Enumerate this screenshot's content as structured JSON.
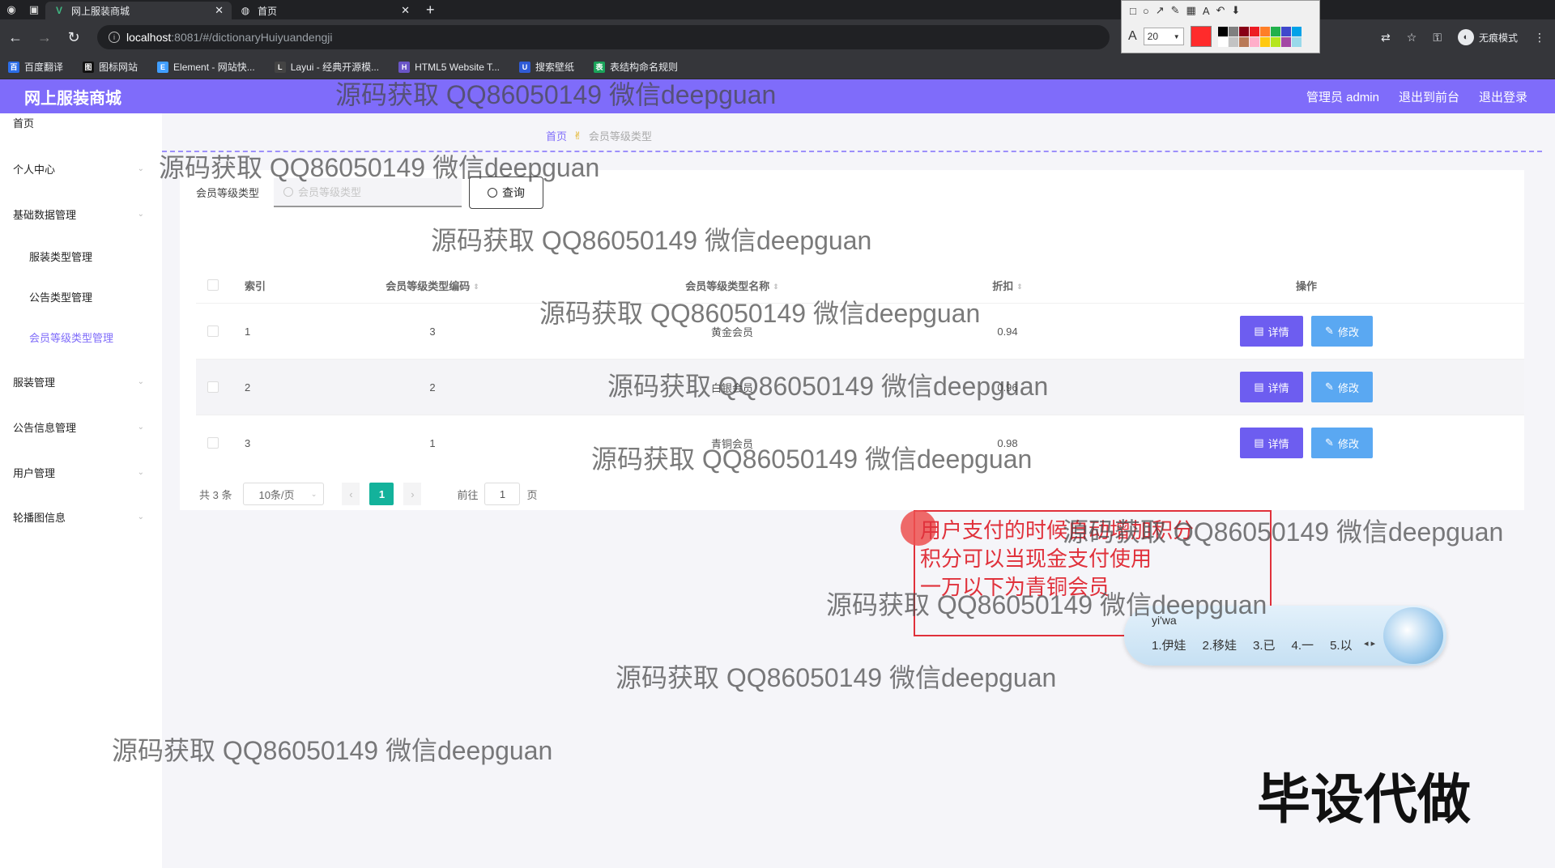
{
  "browser": {
    "tabs": [
      {
        "title": "网上服装商城",
        "active": true
      },
      {
        "title": "首页",
        "active": false
      }
    ],
    "url_host": "localhost",
    "url_path": ":8081/#/dictionaryHuiyuandengji",
    "incognito_label": "无痕模式",
    "bookmarks": [
      {
        "label": "百度翻译",
        "color": "#2b6de8",
        "icon": "百"
      },
      {
        "label": "图标网站",
        "color": "#111111",
        "icon": "图"
      },
      {
        "label": "Element - 网站快...",
        "color": "#409eff",
        "icon": "E"
      },
      {
        "label": "Layui - 经典开源模...",
        "color": "#444444",
        "icon": "L"
      },
      {
        "label": "HTML5 Website T...",
        "color": "#6a55c8",
        "icon": "H"
      },
      {
        "label": "搜索壁纸",
        "color": "#2f5bd6",
        "icon": "U"
      },
      {
        "label": "表结构命名规则",
        "color": "#1aa35a",
        "icon": "表"
      }
    ],
    "annot_size": "20"
  },
  "app": {
    "brand": "网上服装商城",
    "admin_label": "管理员 admin",
    "to_front": "退出到前台",
    "logout": "退出登录",
    "accent": "#7f6cfa"
  },
  "sidebar": {
    "items": [
      {
        "label": "首页",
        "sub": false,
        "active": false,
        "arrow": false
      },
      {
        "label": "个人中心",
        "sub": false,
        "active": false,
        "arrow": true
      },
      {
        "label": "基础数据管理",
        "sub": false,
        "active": false,
        "arrow": true
      },
      {
        "label": "服装类型管理",
        "sub": true,
        "active": false,
        "arrow": false
      },
      {
        "label": "公告类型管理",
        "sub": true,
        "active": false,
        "arrow": false
      },
      {
        "label": "会员等级类型管理",
        "sub": true,
        "active": true,
        "arrow": false
      },
      {
        "label": "服装管理",
        "sub": false,
        "active": false,
        "arrow": true
      },
      {
        "label": "公告信息管理",
        "sub": false,
        "active": false,
        "arrow": true
      },
      {
        "label": "用户管理",
        "sub": false,
        "active": false,
        "arrow": true
      },
      {
        "label": "轮播图信息",
        "sub": false,
        "active": false,
        "arrow": true
      }
    ]
  },
  "breadcrumb": {
    "home": "首页",
    "current": "会员等级类型"
  },
  "search": {
    "label": "会员等级类型",
    "placeholder": "会员等级类型",
    "button": "查询"
  },
  "table": {
    "headers": {
      "index": "索引",
      "code": "会员等级类型编码",
      "name": "会员等级类型名称",
      "discount": "折扣",
      "ops": "操作"
    },
    "rows": [
      {
        "index": "1",
        "code": "3",
        "name": "黄金会员",
        "discount": "0.94"
      },
      {
        "index": "2",
        "code": "2",
        "name": "白银会员",
        "discount": "0.96"
      },
      {
        "index": "3",
        "code": "1",
        "name": "青铜会员",
        "discount": "0.98"
      }
    ],
    "detail_label": "详情",
    "edit_label": "修改"
  },
  "pagination": {
    "total": "共 3 条",
    "page_size": "10条/页",
    "current_page": "1",
    "goto_prefix": "前往",
    "goto_value": "1",
    "goto_suffix": "页"
  },
  "annotation": {
    "text": "用户支付的时候自动增加积分\n积分可以当现金支付使用\n一万以下为青铜会员"
  },
  "ime": {
    "pinyin": "yi'wa",
    "candidates": [
      "1.伊娃",
      "2.移娃",
      "3.已",
      "4.一",
      "5.以"
    ]
  },
  "watermark": "源码获取 QQ86050149 微信deepguan",
  "corner_tag": "毕设代做"
}
